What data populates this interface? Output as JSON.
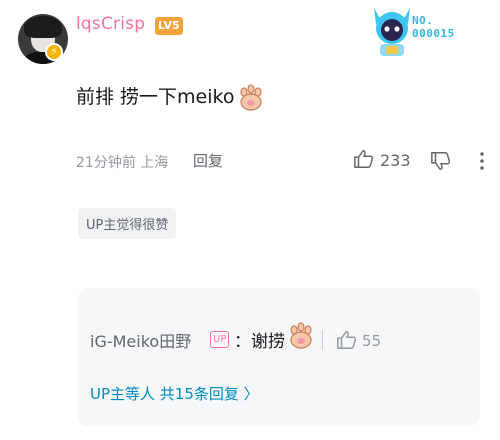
{
  "comment": {
    "username": "lqsCrisp",
    "level_badge": "LV5",
    "decoration_label_line1": "NO.",
    "decoration_label_line2": "000015",
    "content_text": "前排 捞一下meiko",
    "time": "21分钟前",
    "location": "上海",
    "reply_label": "回复",
    "like_count": "233",
    "up_tag": "UP主觉得很赞"
  },
  "sub_reply": {
    "username": "iG-Meiko田野",
    "up_badge": "UP",
    "text": "：谢捞",
    "like_count": "55"
  },
  "more_replies": "UP主等人 共15条回复 〉",
  "colors": {
    "username": "#fb7299",
    "link_blue": "#008ac5",
    "level_badge": "#f6a23c"
  },
  "icons": [
    "avatar",
    "bolt-icon",
    "paw-emoji",
    "thumb-up-icon",
    "thumb-down-icon",
    "more-icon"
  ]
}
